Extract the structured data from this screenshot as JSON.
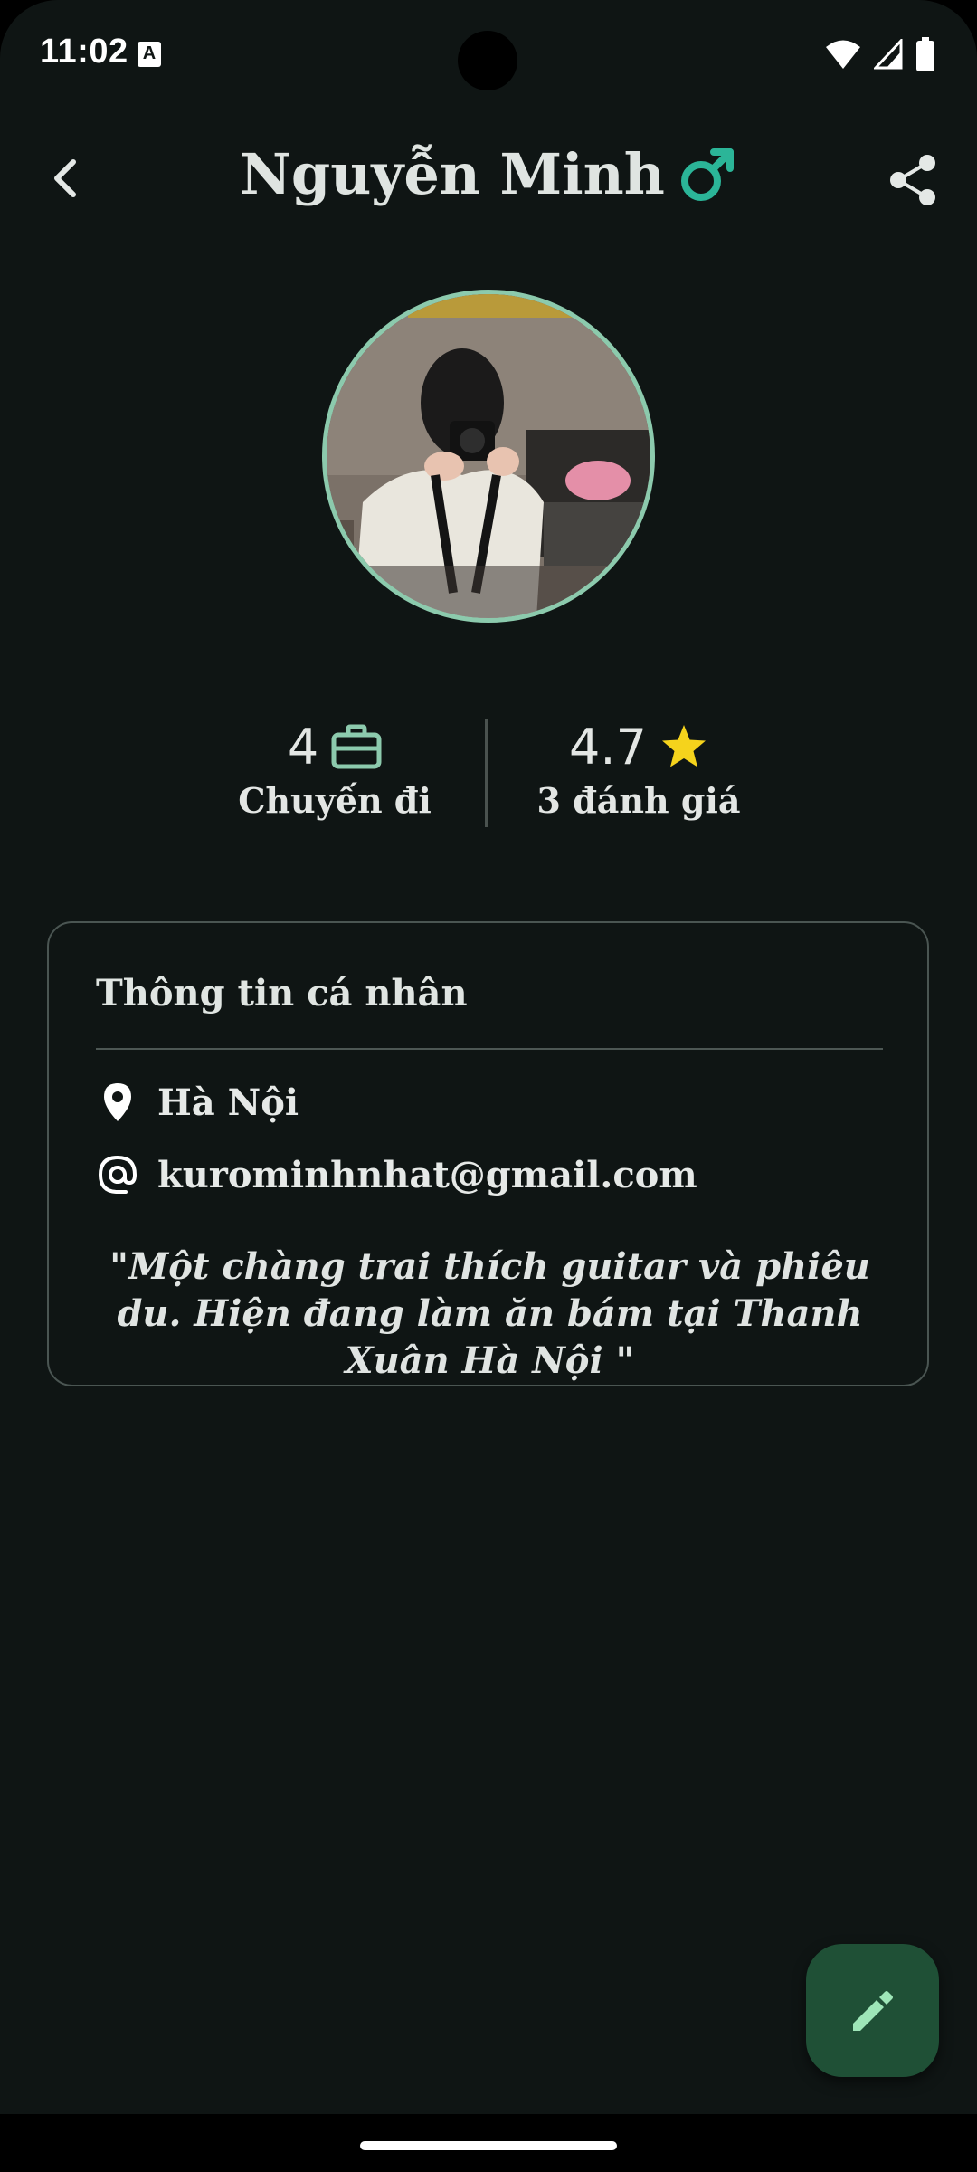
{
  "status_bar": {
    "time": "11:02",
    "notification_icon_letter": "A",
    "icons": [
      "wifi-icon",
      "cellular-signal-icon",
      "battery-icon"
    ]
  },
  "app_bar": {
    "title": "Nguyễn Minh",
    "gender_icon": "male-symbol-icon",
    "gender_color": "#2bb598",
    "back_icon": "chevron-left-icon",
    "share_icon": "share-icon"
  },
  "profile": {
    "avatar": "profile-photo"
  },
  "stats": {
    "trips_value": "4",
    "trips_label": "Chuyến đi",
    "trips_icon": "briefcase-icon",
    "rating_value": "4.7",
    "rating_label": "3 đánh giá",
    "rating_icon": "star-icon",
    "star_color": "#f5d31c",
    "briefcase_color": "#8ccaad"
  },
  "info_card": {
    "title": "Thông tin cá nhân",
    "location": "Hà Nội",
    "location_icon": "location-pin-icon",
    "email": "kurominhnhat@gmail.com",
    "email_icon": "at-sign-icon",
    "bio": "\"Một chàng trai thích guitar và phiêu du. Hiện đang làm ăn bám tại Thanh Xuân Hà Nội \""
  },
  "fab": {
    "icon": "edit-pencil-icon",
    "background": "#1f5036",
    "icon_color": "#9ee6b8"
  }
}
